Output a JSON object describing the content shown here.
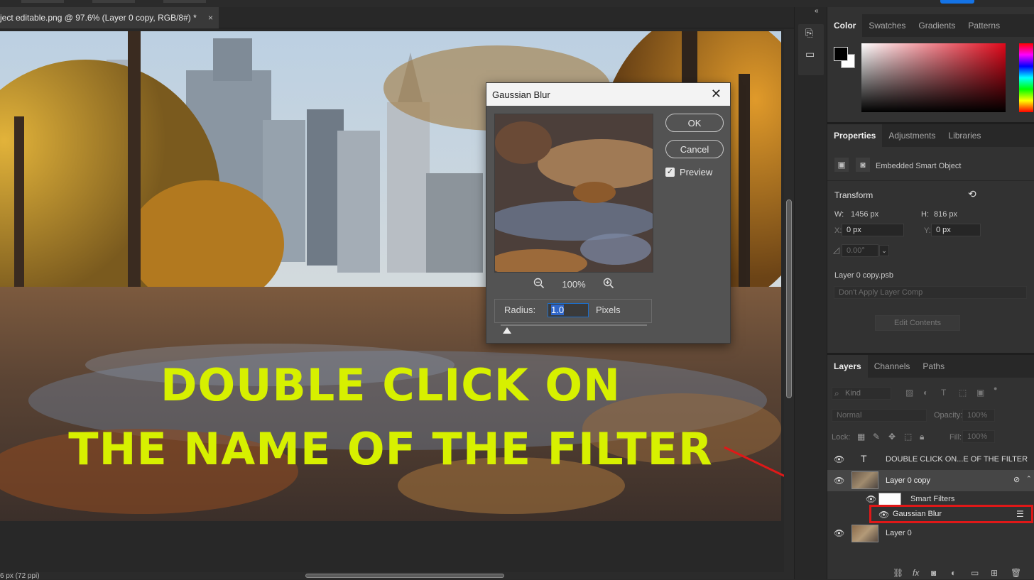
{
  "document": {
    "tab_title": "ject editable.png @ 97.6% (Layer 0 copy, RGB/8#) *",
    "close_glyph": "×",
    "status": "6 px (72 ppi)"
  },
  "overlay": {
    "line1": "DOUBLE CLICK ON",
    "line2": "THE NAME OF THE FILTER",
    "color": "#d7f000"
  },
  "dialog": {
    "title": "Gaussian Blur",
    "ok_label": "OK",
    "cancel_label": "Cancel",
    "preview_label": "Preview",
    "preview_checked": true,
    "zoom_level": "100%",
    "radius_label": "Radius:",
    "radius_value": "1.0",
    "radius_unit": "Pixels"
  },
  "color_panel": {
    "tabs": [
      "Color",
      "Swatches",
      "Gradients",
      "Patterns"
    ],
    "foreground": "#000000",
    "background": "#ffffff"
  },
  "properties_panel": {
    "tabs": [
      "Properties",
      "Adjustments",
      "Libraries"
    ],
    "object_type": "Embedded Smart Object",
    "transform_title": "Transform",
    "w_label": "W:",
    "w_value": "1456 px",
    "h_label": "H:",
    "h_value": "816 px",
    "x_label": "X:",
    "x_value": "0 px",
    "y_label": "Y:",
    "y_value": "0 px",
    "angle_value": "0.00°",
    "file_name": "Layer 0 copy.psb",
    "layer_comp": "Don't Apply Layer Comp",
    "edit_contents": "Edit Contents"
  },
  "layers_panel": {
    "tabs": [
      "Layers",
      "Channels",
      "Paths"
    ],
    "filter_kind": "Kind",
    "blend_mode": "Normal",
    "opacity_label": "Opacity:",
    "opacity_value": "100%",
    "lock_label": "Lock:",
    "fill_label": "Fill:",
    "fill_value": "100%",
    "layers": [
      {
        "name": "DOUBLE CLICK ON...E OF THE FILTER",
        "type": "text"
      },
      {
        "name": "Layer 0 copy",
        "type": "smart"
      },
      {
        "name": "Smart Filters",
        "type": "smart-filters"
      },
      {
        "name": "Gaussian Blur",
        "type": "filter"
      },
      {
        "name": "Layer 0",
        "type": "pixel"
      }
    ],
    "highlight_color": "#e01818"
  }
}
